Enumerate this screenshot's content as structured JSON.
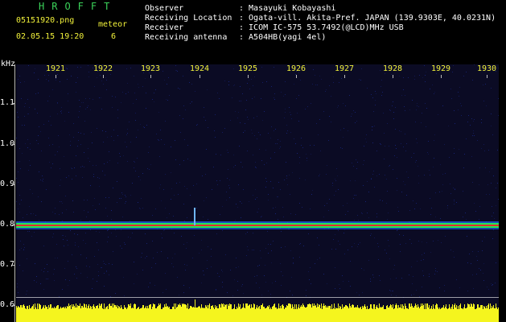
{
  "header": {
    "brand": "HROFFT",
    "filename": "05151920.png",
    "datetime": "02.05.15 19:20",
    "meteor_label": "meteor",
    "meteor_count": "6",
    "labels": {
      "observer": "Observer",
      "location": "Receiving Location",
      "receiver": "Receiver",
      "antenna": "Receiving antenna"
    },
    "values": {
      "observer": ": Masayuki Kobayashi",
      "location": ": Ogata-vill. Akita-Pref. JAPAN (139.9303E, 40.0231N)",
      "receiver": ": ICOM IC-575 53.7492(@LCD)MHz USB",
      "antenna": ": A504HB(yagi 4el)"
    }
  },
  "spectrogram": {
    "unit_label": "kHz",
    "x_ticks": [
      "1921",
      "1922",
      "1923",
      "1924",
      "1925",
      "1926",
      "1927",
      "1928",
      "1929",
      "1930"
    ],
    "y_ticks": [
      "1.1",
      "1.0",
      "0.9",
      "0.8",
      "0.7",
      "0.6"
    ],
    "colors": {
      "background": "#0b0b24",
      "noise": "#1a2a8a",
      "carrier": "#2aff5a",
      "carrier_core": "#ff3030",
      "amplitude": "#f5f51e",
      "ticks": "#f2f23a"
    }
  }
}
